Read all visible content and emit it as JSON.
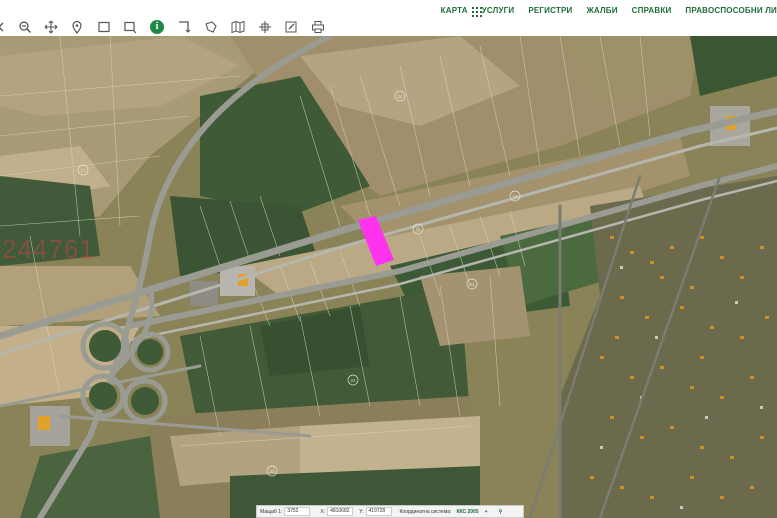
{
  "nav": {
    "items": [
      "КАРТА",
      "УСЛУГИ",
      "РЕГИСТРИ",
      "ЖАЛБИ",
      "СПРАВКИ",
      "ПРАВОСПОСОБНИ ЛИ"
    ]
  },
  "toolbar": {
    "icons": [
      "zoom-out-icon",
      "pan-icon",
      "pin-icon",
      "rectangle-icon",
      "rectangle-select-icon",
      "info-icon",
      "measure-icon",
      "polygon-icon",
      "map-icon",
      "crosshair-icon",
      "edit-icon",
      "print-icon"
    ],
    "info_glyph": "i"
  },
  "map": {
    "parcel_label": "244761",
    "parcel_numbers": [
      "13",
      "17",
      "20",
      "21",
      "22",
      "23",
      "24"
    ],
    "highlight_color": "#ff33ee"
  },
  "status": {
    "scale_label": "Мащаб 1:",
    "scale_value": "3752",
    "x_label": "X:",
    "x_value": "4810682",
    "y_label": "Y:",
    "y_value": "419728",
    "crs_label": "Координатна система:",
    "crs_value": "ККС 2005",
    "plus": "+",
    "search_glyph": "⚲"
  }
}
